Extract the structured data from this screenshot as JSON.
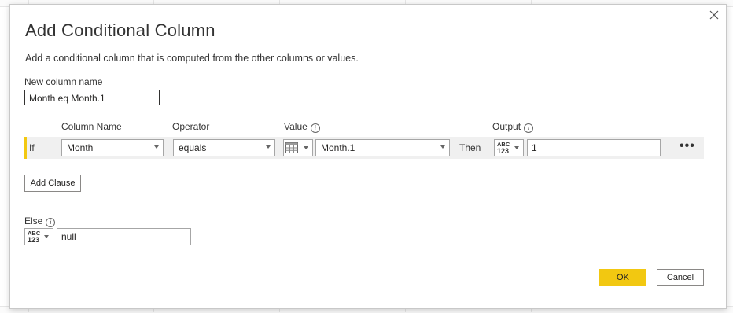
{
  "dialog": {
    "title": "Add Conditional Column",
    "description": "Add a conditional column that is computed from the other columns or values.",
    "new_column_label": "New column name",
    "new_column_value": "Month eq Month.1"
  },
  "headers": {
    "column_name": "Column Name",
    "operator": "Operator",
    "value": "Value",
    "output": "Output"
  },
  "clause": {
    "if_label": "If",
    "column": "Month",
    "operator": "equals",
    "value": "Month.1",
    "then_label": "Then",
    "output_type_top": "ABC",
    "output_type_bottom": "123",
    "output_value": "1"
  },
  "add_clause_label": "Add Clause",
  "else": {
    "label": "Else",
    "type_top": "ABC",
    "type_bottom": "123",
    "value": "null"
  },
  "buttons": {
    "ok": "OK",
    "cancel": "Cancel"
  },
  "colors": {
    "accent": "#f2c811"
  }
}
